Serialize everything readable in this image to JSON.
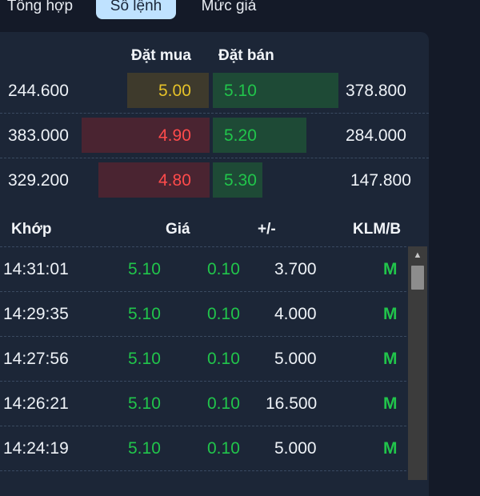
{
  "tabs": [
    {
      "label": "Tổng hợp"
    },
    {
      "label": "Sổ lệnh"
    },
    {
      "label": "Mức giá"
    }
  ],
  "orderbook": {
    "bid_header": "Đặt mua",
    "ask_header": "Đặt bán",
    "rows": [
      {
        "bid_vol": "244.600",
        "bid_price": "5.00",
        "ask_price": "5.10",
        "ask_vol": "378.800"
      },
      {
        "bid_vol": "383.000",
        "bid_price": "4.90",
        "ask_price": "5.20",
        "ask_vol": "284.000"
      },
      {
        "bid_vol": "329.200",
        "bid_price": "4.80",
        "ask_price": "5.30",
        "ask_vol": "147.800"
      }
    ]
  },
  "trades": {
    "headers": {
      "time": "Khớp",
      "price": "Giá",
      "change": "+/-",
      "side": "KLM/B"
    },
    "rows": [
      {
        "time": "14:31:01",
        "price": "5.10",
        "change": "0.10",
        "volume": "3.700",
        "side": "M"
      },
      {
        "time": "14:29:35",
        "price": "5.10",
        "change": "0.10",
        "volume": "4.000",
        "side": "M"
      },
      {
        "time": "14:27:56",
        "price": "5.10",
        "change": "0.10",
        "volume": "5.000",
        "side": "M"
      },
      {
        "time": "14:26:21",
        "price": "5.10",
        "change": "0.10",
        "volume": "16.500",
        "side": "M"
      },
      {
        "time": "14:24:19",
        "price": "5.10",
        "change": "0.10",
        "volume": "5.000",
        "side": "M"
      }
    ]
  },
  "colors": {
    "up": "#21c54b",
    "down": "#ff4b4b",
    "ref": "#e6c229",
    "bid_bar_down": "#4a2431",
    "bid_bar_ref": "#3e3a2c",
    "ask_bar": "#1e4a36"
  }
}
